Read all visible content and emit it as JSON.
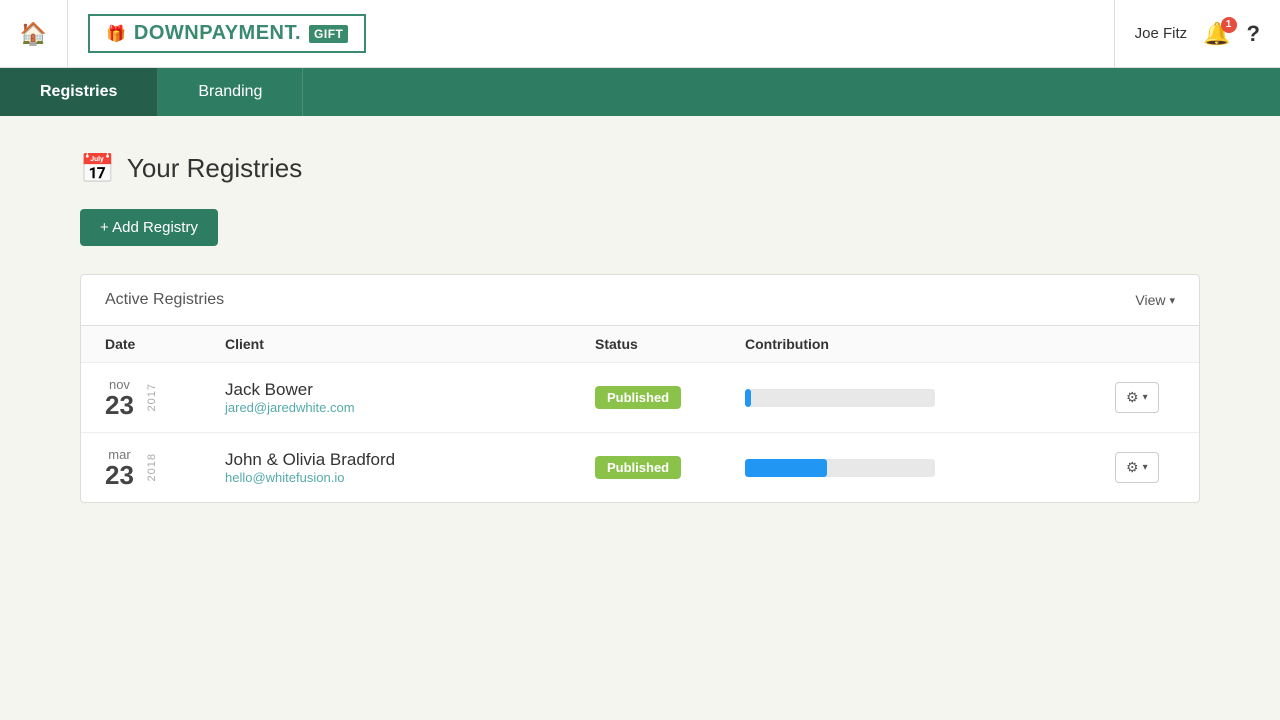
{
  "header": {
    "home_icon": "🏠",
    "logo_text": "DOWNPAYMENT.",
    "logo_suffix": "GIFT",
    "gift_icon": "🎁",
    "user_name": "Joe Fitz",
    "bell_badge": "1",
    "help_label": "?"
  },
  "nav": {
    "items": [
      {
        "label": "Registries",
        "active": true
      },
      {
        "label": "Branding",
        "active": false
      }
    ]
  },
  "main": {
    "page_title": "Your Registries",
    "add_button_label": "+ Add Registry",
    "table": {
      "section_title": "Active Registries",
      "view_label": "View",
      "columns": [
        "Date",
        "Client",
        "Status",
        "Contribution"
      ],
      "rows": [
        {
          "date_month": "nov",
          "date_day": "23",
          "date_year": "2017",
          "client_name": "Jack Bower",
          "client_email": "jared@jaredwhite.com",
          "status": "Published",
          "contribution_pct": 3
        },
        {
          "date_month": "mar",
          "date_day": "23",
          "date_year": "2018",
          "client_name": "John & Olivia Bradford",
          "client_email": "hello@whitefusion.io",
          "status": "Published",
          "contribution_pct": 43
        }
      ]
    }
  }
}
